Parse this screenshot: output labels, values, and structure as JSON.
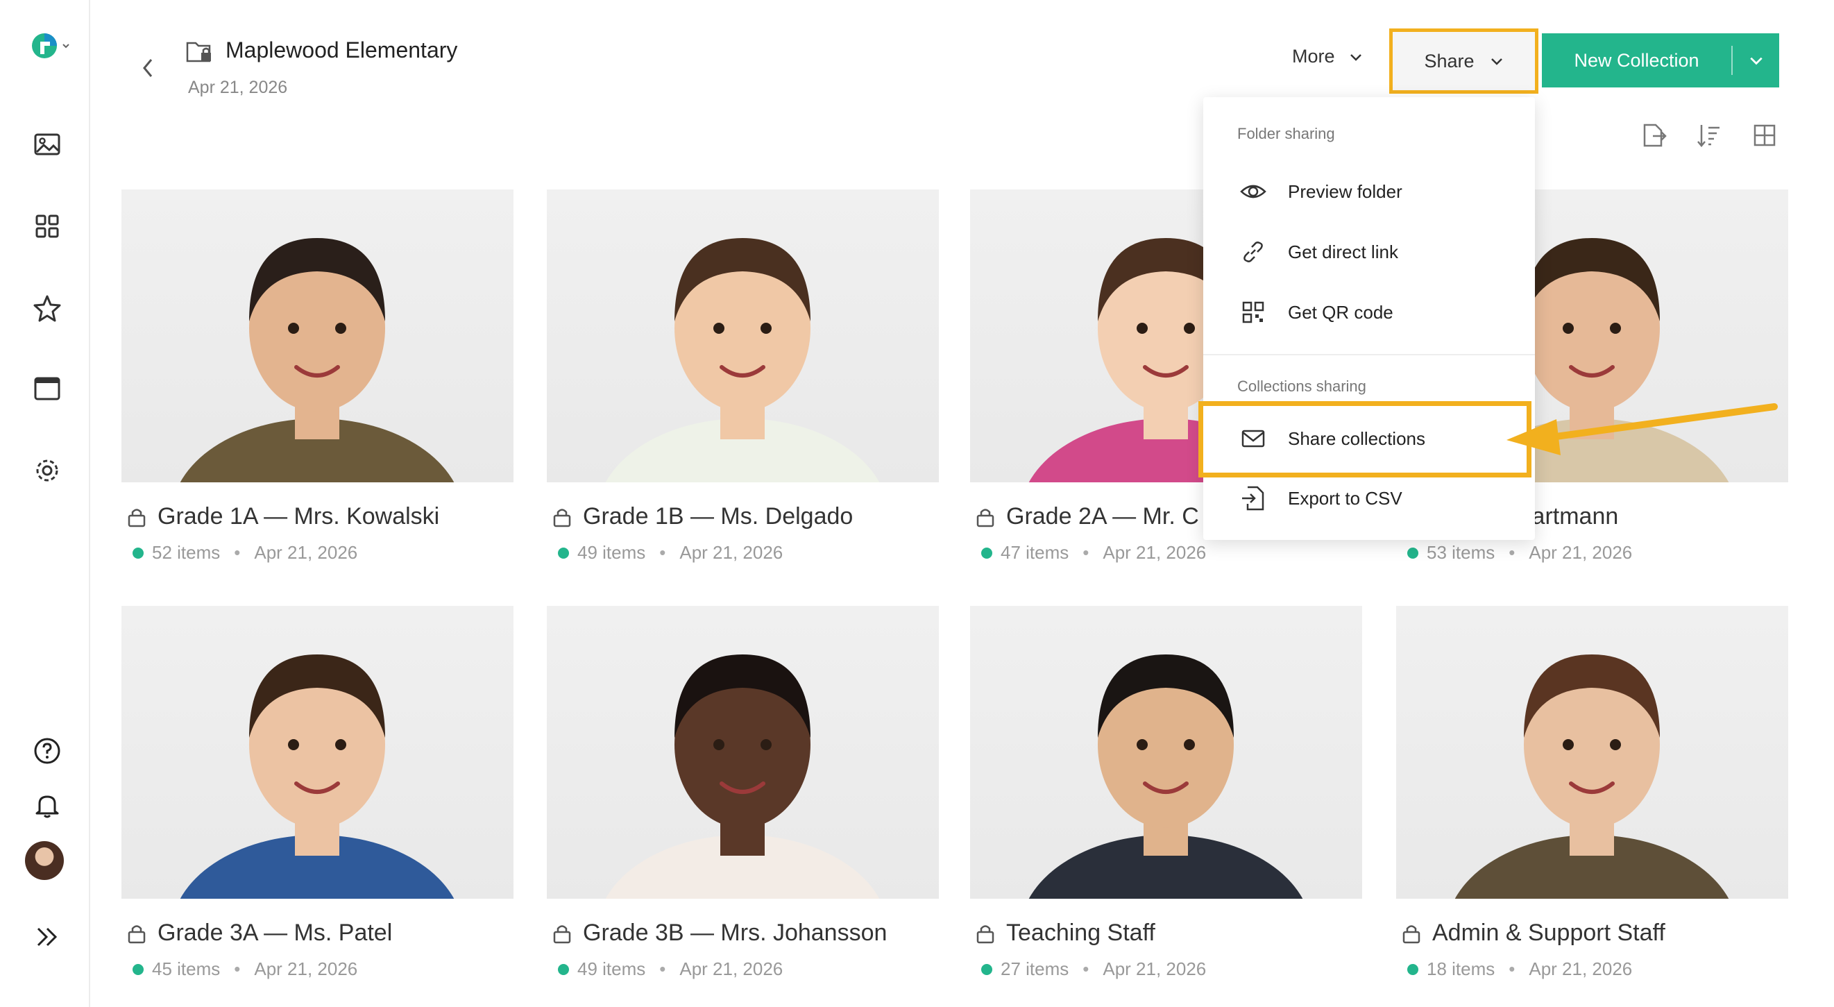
{
  "header": {
    "folder_title": "Maplewood Elementary",
    "folder_date": "Apr 21, 2026",
    "more_label": "More",
    "share_label": "Share",
    "new_collection_label": "New Collection"
  },
  "sidebar": {
    "items": [
      {
        "icon": "photos-icon"
      },
      {
        "icon": "dashboard-icon"
      },
      {
        "icon": "star-icon"
      },
      {
        "icon": "window-icon"
      },
      {
        "icon": "gear-icon"
      },
      {
        "icon": "help-icon"
      },
      {
        "icon": "bell-icon"
      },
      {
        "icon": "expand-icon"
      }
    ]
  },
  "share_menu": {
    "folder_section": "Folder sharing",
    "preview_folder": "Preview folder",
    "direct_link": "Get direct link",
    "qr_code": "Get QR code",
    "collections_section": "Collections sharing",
    "share_collections": "Share collections",
    "export_csv": "Export to CSV"
  },
  "collections": [
    {
      "title": "Grade 1A — Mrs. Kowalski",
      "count": "52 items",
      "date": "Apr 21, 2026"
    },
    {
      "title": "Grade 1B — Ms. Delgado",
      "count": "49 items",
      "date": "Apr 21, 2026"
    },
    {
      "title": "Grade 2A — Mr. C",
      "count": "47 items",
      "date": "Apr 21, 2026"
    },
    {
      "title": "— Mrs. Hartmann",
      "count": "53 items",
      "date": "Apr 21, 2026"
    },
    {
      "title": "Grade 3A — Ms. Patel",
      "count": "45 items",
      "date": "Apr 21, 2026"
    },
    {
      "title": "Grade 3B — Mrs. Johansson",
      "count": "49 items",
      "date": "Apr 21, 2026"
    },
    {
      "title": "Teaching Staff",
      "count": "27 items",
      "date": "Apr 21, 2026"
    },
    {
      "title": "Admin & Support Staff",
      "count": "18 items",
      "date": "Apr 21, 2026"
    }
  ],
  "colors": {
    "accent_green": "#23b58c",
    "highlight_yellow": "#f2b01e"
  }
}
